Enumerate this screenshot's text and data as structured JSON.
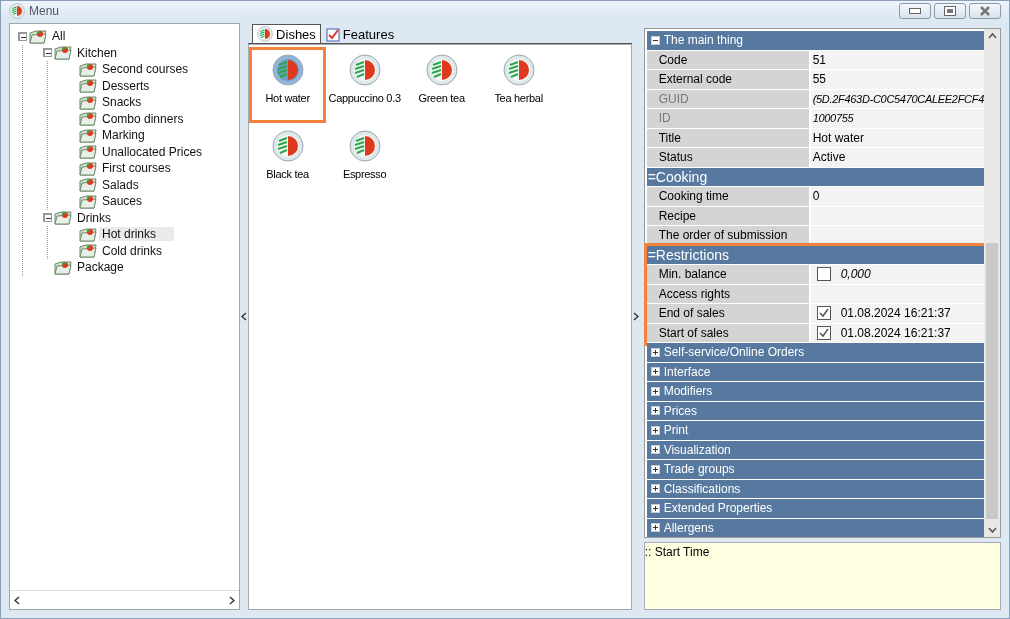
{
  "window": {
    "title": "Menu"
  },
  "tree": {
    "label": "All",
    "expanded": true,
    "selected": false,
    "children": [
      {
        "label": "Kitchen",
        "expanded": true,
        "selected": false,
        "children": [
          {
            "label": "Second courses",
            "selected": false
          },
          {
            "label": "Desserts",
            "selected": false
          },
          {
            "label": "Snacks",
            "selected": false
          },
          {
            "label": "Combo dinners",
            "selected": false
          },
          {
            "label": "Marking",
            "selected": false
          },
          {
            "label": "Unallocated Prices",
            "selected": false
          },
          {
            "label": "First courses",
            "selected": false
          },
          {
            "label": "Salads",
            "selected": false
          },
          {
            "label": "Sauces",
            "selected": false
          }
        ]
      },
      {
        "label": "Drinks",
        "expanded": true,
        "selected": false,
        "children": [
          {
            "label": "Hot drinks",
            "selected": true
          },
          {
            "label": "Cold drinks",
            "selected": false
          }
        ]
      },
      {
        "label": "Package",
        "selected": false
      }
    ]
  },
  "tabs": [
    {
      "label": "Dishes",
      "selected": true
    },
    {
      "label": "Features",
      "selected": false
    }
  ],
  "dishes": [
    {
      "name": "Hot water",
      "selected": true
    },
    {
      "name": "Cappuccino 0.3",
      "selected": false
    },
    {
      "name": "Green tea",
      "selected": false
    },
    {
      "name": "Tea herbal",
      "selected": false
    },
    {
      "name": "Black tea",
      "selected": false
    },
    {
      "name": "Espresso",
      "selected": false
    }
  ],
  "sections": [
    {
      "title": "The main thing",
      "expanded": true,
      "highlighted": false,
      "rows": [
        {
          "kind": "text",
          "label": "Code",
          "value": "51"
        },
        {
          "kind": "text",
          "label": "External code",
          "value": "55"
        },
        {
          "kind": "text",
          "label": "GUID",
          "value": "(5D.2F463D-C0C5470CALEE2FCF4",
          "disabled": true
        },
        {
          "kind": "text",
          "label": "ID",
          "value": "1000755",
          "disabled": true
        },
        {
          "kind": "text",
          "label": "Title",
          "value": "Hot water"
        },
        {
          "kind": "text",
          "label": "Status",
          "value": "Active"
        }
      ]
    },
    {
      "title": "=Cooking",
      "expanded": true,
      "highlighted": false,
      "rows": [
        {
          "kind": "text",
          "label": "Cooking time",
          "value": "0"
        },
        {
          "kind": "text",
          "label": "Recipe"
        },
        {
          "kind": "text",
          "label": "The order of submission"
        }
      ]
    },
    {
      "title": "=Restrictions",
      "expanded": true,
      "highlighted": true,
      "rows": [
        {
          "kind": "check",
          "label": "Min. balance",
          "checked": false,
          "value": "0,000"
        },
        {
          "kind": "text",
          "label": "Access rights"
        },
        {
          "kind": "check",
          "label": "End of sales",
          "checked": true,
          "value": "01.08.2024 16:21:37"
        },
        {
          "kind": "check",
          "label": "Start of sales",
          "checked": true,
          "value": "01.08.2024 16:21:37"
        }
      ]
    },
    {
      "title": "Self-service/Online Orders",
      "expanded": false,
      "highlighted": false
    },
    {
      "title": "Interface",
      "expanded": false,
      "highlighted": false
    },
    {
      "title": "Modifiers",
      "expanded": false,
      "highlighted": false
    },
    {
      "title": "Prices",
      "expanded": false,
      "highlighted": false
    },
    {
      "title": "Print",
      "expanded": false,
      "highlighted": false
    },
    {
      "title": "Visualization",
      "expanded": false,
      "highlighted": false
    },
    {
      "title": "Trade groups",
      "expanded": false,
      "highlighted": false
    },
    {
      "title": "Classifications",
      "expanded": false,
      "highlighted": false
    },
    {
      "title": "Extended Properties",
      "expanded": false,
      "highlighted": false
    },
    {
      "title": "Allergens",
      "expanded": false,
      "highlighted": false
    }
  ],
  "description": ":: Start Time"
}
